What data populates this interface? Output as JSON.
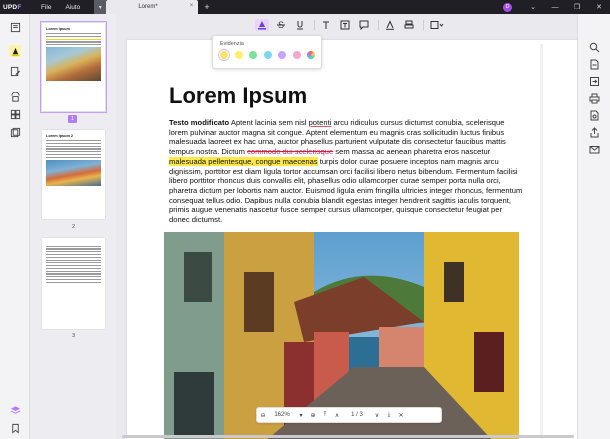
{
  "app": {
    "logo_main": "UPD",
    "logo_accent": "F"
  },
  "menu": {
    "file": "File",
    "help": "Aiuto"
  },
  "tab": {
    "title": "Lorem*",
    "close": "×",
    "add": "+"
  },
  "user": {
    "avatar_letter": "D"
  },
  "window": {
    "chevron": "⌄",
    "minimize": "—",
    "restore": "❐",
    "close": "✕"
  },
  "highlight_popover": {
    "title": "Evidenzia",
    "colors": [
      "#ffe566",
      "#fff06a",
      "#7de39a",
      "#7fd4f0",
      "#c8a6ff",
      "#f6a6cf",
      "#ff8b4d"
    ]
  },
  "thumbnails": [
    {
      "page": "1",
      "title": "Lorem Ipsum",
      "selected": true
    },
    {
      "page": "2",
      "title": "Lorem Ipsum 2",
      "selected": false
    },
    {
      "page": "3",
      "title": "",
      "selected": false
    }
  ],
  "document": {
    "title": "Lorem Ipsum",
    "p1_bold": "Testo modificato",
    "p1_a": " Aptent lacinia sem nisl ",
    "p1_underlined": "potenti",
    "p1_b": " arcu ridiculus cursus dictumst conubia, scelerisque lorem pulvinar auctor magna sit congue. Aptent elementum eu magnis cras sollicitudin luctus finibus malesuada laoreet ex hac urna, auctor phasellus parturient vulputate dis consectetur faucibus mattis tempus nostra. Dictum ",
    "p1_strike": "commodo dui scelerisque",
    "p1_c": " sem massa ac aenean pharetra eros nascetur",
    "p2_highlight": "malesuada pellentesque, congue maecenas",
    "p2_rest": " turpis dolor curae posuere inceptos nam magnis arcu dignissim, porttitor est diam ligula tortor accumsan orci facilisi libero netus bibendum. Fermentum facilisi libero porttitor rhoncus duis convallis elit, phasellus odio ullamcorper curae semper porta nulla orci, pharetra dictum per lobortis nam auctor. Euismod ligula enim fringilla ultricies integer rhoncus, fermentum consequat tellus odio. Dapibus nulla conubia blandit egestas integer hendrerit sagittis iaculis torquent, primis augue venenatis nascetur fusce semper cursus ullamcorper, quisque consectetur feugiat per donec dictumst."
  },
  "zoom_bar": {
    "zoom_out": "⊖",
    "zoom_value": "162%",
    "dropdown": "▾",
    "zoom_in": "⊕",
    "first": "⤒",
    "prev": "∧",
    "page_display": "1 / 3",
    "next": "∨",
    "last": "⤓",
    "close": "✕"
  }
}
